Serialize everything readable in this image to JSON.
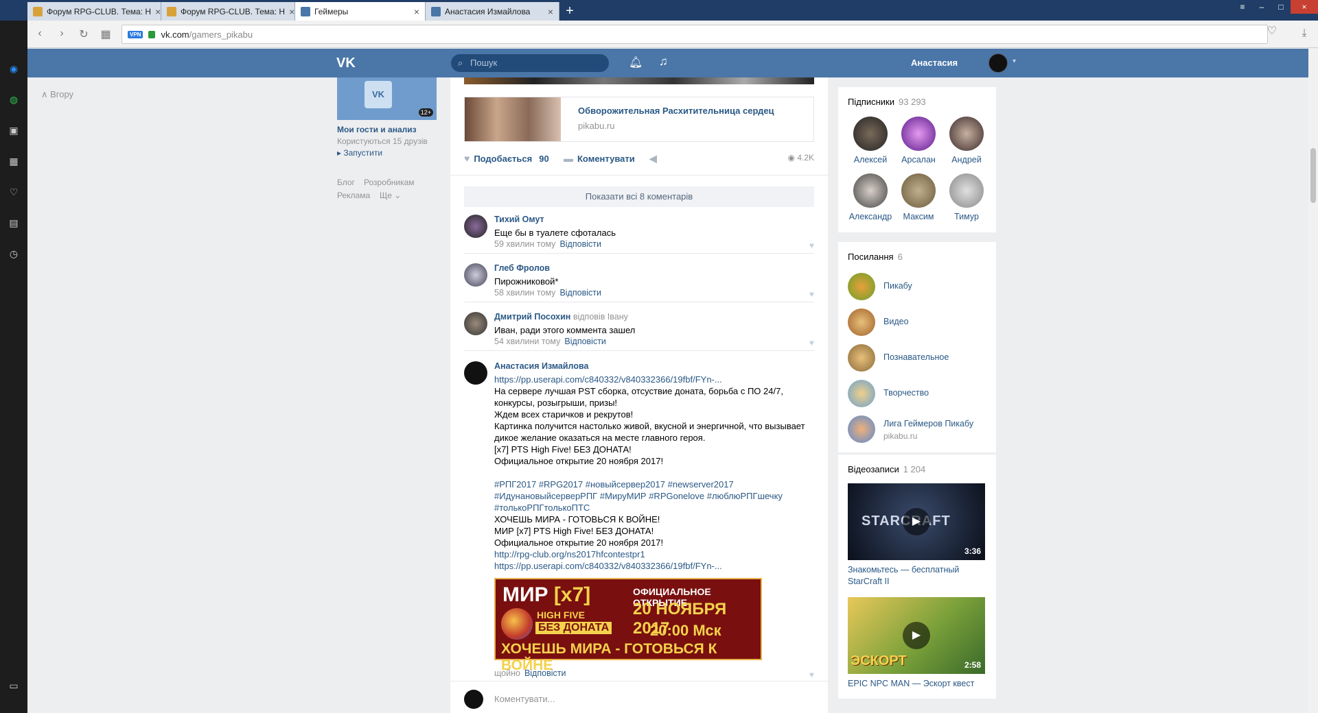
{
  "browser": {
    "tabs": [
      {
        "label": "Форум RPG-CLUB. Тема: Н"
      },
      {
        "label": "Форум RPG-CLUB. Тема: Н"
      },
      {
        "label": "Геймеры"
      },
      {
        "label": "Анастасия Измайлова"
      }
    ],
    "new_tab": "+",
    "url_host": "vk.com",
    "url_path": "/gamers_pikabu",
    "vpn_label": "VPN",
    "colors": {
      "opera_red": "#cc1b1b",
      "vk_blue": "#4a76a8",
      "link": "#2a5885"
    }
  },
  "header": {
    "logo": "VK",
    "search_placeholder": "Пошук",
    "user_name": "Анастасия"
  },
  "left": {
    "up_link": "Вгору",
    "game_badge": "12+",
    "game_title": "Мои гости и анализ",
    "game_users": "Користуються 15 друзів",
    "game_launch": "▸ Запустити",
    "footer": [
      "Блог",
      "Розробникам",
      "Реклама",
      "Ще ⌄"
    ]
  },
  "post": {
    "share_title": "Обворожительная Расхитительница сердец",
    "share_source": "pikabu.ru",
    "like_label": "Подобається",
    "like_count": "90",
    "comment_label": "Коментувати",
    "views": "4.2K",
    "show_all": "Показати всі 8 коментарів"
  },
  "comments": [
    {
      "name": "Тихий Омут",
      "text": "Еще бы в туалете сфоталась",
      "time": "59 хвилин тому",
      "reply": "Відповісти"
    },
    {
      "name": "Глеб Фролов",
      "text": "Пирожниковой*",
      "time": "58 хвилин тому",
      "reply": "Відповісти"
    },
    {
      "name": "Дмитрий Посохин",
      "reply_to": "відповів Івану",
      "text": "Иван, ради этого коммента зашел",
      "time": "54 хвилини тому",
      "reply": "Відповісти"
    }
  ],
  "big_comment": {
    "name": "Анастасия Измайлова",
    "lines": [
      "https://pp.userapi.com/c840332/v840332366/19fbf/FYn-...",
      "На сервере лучшая PST сборка, отсуствие доната, борьба с ПО 24/7,",
      "конкурсы, розыгрыши, призы!",
      "Ждем всех старичков и рекрутов!",
      "Картинка получится настолько живой, вкусной и энергичной, что вызывает",
      "дикое желание оказаться на месте главного героя.",
      "[x7] PTS High Five! БЕЗ ДОНАТА!",
      "Официальное открытие 20 ноября 2017!",
      "",
      "#РПГ2017 #RPG2017 #новыйсервер2017 #newserver2017",
      "#ИдунановыйсерверРПГ #МируМИР #RPGonelove #люблюРПГшечку",
      "#толькоРПГтолькоПТС",
      "ХОЧЕШЬ МИРА - ГОТОВЬСЯ К ВОЙНЕ!",
      "МИР [x7] PTS High Five! БЕЗ ДОНАТА!",
      "Официальное открытие 20 ноября 2017!",
      "http://rpg-club.org/ns2017hfcontestpr1",
      "https://pp.userapi.com/c840332/v840332366/19fbf/FYn-..."
    ],
    "banner": {
      "mir": "МИР",
      "x7": "[x7]",
      "official": "ОФИЦИАЛЬНОЕ ОТКРЫТИЕ",
      "date": "20 НОЯБРЯ 2017",
      "time": "20:00 Мск",
      "highfive": "HIGH FIVE",
      "nodonat": "БЕЗ ДОНАТА",
      "slogan": "ХОЧЕШЬ МИРА - ГОТОВЬСЯ К ВОЙНЕ"
    },
    "time": "щойно",
    "reply": "Відповісти"
  },
  "comment_input_placeholder": "Коментувати...",
  "subscribers": {
    "title": "Підписники",
    "count": "93 293",
    "people": [
      "Алексей",
      "Арсалан",
      "Андрей",
      "Александр",
      "Максим",
      "Тимур"
    ]
  },
  "links": {
    "title": "Посилання",
    "count": "6",
    "items": [
      {
        "label": "Пикабу"
      },
      {
        "label": "Видео"
      },
      {
        "label": "Познавательное"
      },
      {
        "label": "Творчество"
      },
      {
        "label": "Лига Геймеров Пикабу",
        "sub": "pikabu.ru"
      }
    ]
  },
  "videos": {
    "title": "Відеозаписи",
    "count": "1 204",
    "items": [
      {
        "title": "Знакомьтесь — бесплатный StarCraft II",
        "duration": "3:36",
        "thumb_text": "STARCRAFT"
      },
      {
        "title": "EPIC NPC MAN — Эскорт квест",
        "duration": "2:58",
        "thumb_text": "ЭСКОРТ"
      }
    ]
  }
}
